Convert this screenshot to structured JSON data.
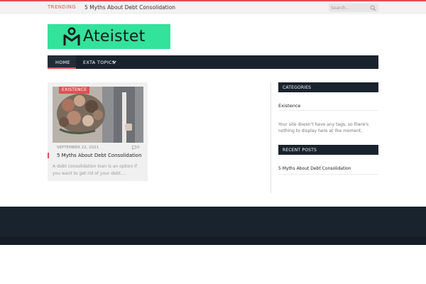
{
  "topbar": {
    "trending_label": "TRENDING",
    "trending_item": "5 Myths About Debt Consolidation",
    "search_placeholder": "Search..."
  },
  "logo": {
    "text": "Ateistet",
    "color": "#33e29b"
  },
  "nav": {
    "items": [
      {
        "label": "HOME",
        "active": true
      },
      {
        "label": "EXTA TOPICS",
        "has_dropdown": true
      }
    ]
  },
  "post": {
    "category": "EXISTENCE",
    "date": "SEPTEMBER 22, 2021",
    "comment_count": "0",
    "title": "5 Myths About Debt Consolidation",
    "excerpt": "A debt consolidation loan is an option if you want to get rid of your debt...."
  },
  "sidebar": {
    "categories": {
      "heading": "CATEGORIES",
      "items": [
        "Existence"
      ],
      "tags_message": "Your site doesn't have any tags, so there's nothing to display here at the moment."
    },
    "recent_posts": {
      "heading": "RECENT POSTS",
      "items": [
        "5 Myths About Debt Consolidation"
      ]
    }
  },
  "colors": {
    "accent": "#e54e53",
    "dark": "#19232d",
    "logo_bg": "#33e29b"
  },
  "icons": [
    "search-icon",
    "chevron-down-icon",
    "comment-icon",
    "logo-mark-icon"
  ]
}
